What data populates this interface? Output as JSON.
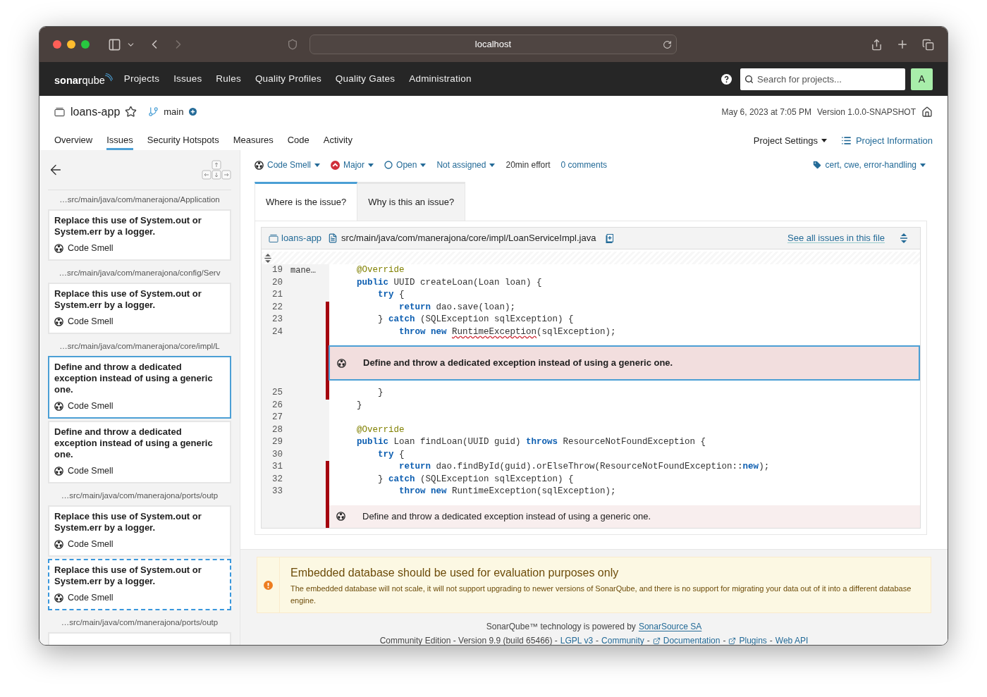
{
  "browser": {
    "url": "localhost"
  },
  "nav": {
    "logo": [
      "sonar",
      "qube"
    ],
    "items": [
      "Projects",
      "Issues",
      "Rules",
      "Quality Profiles",
      "Quality Gates",
      "Administration"
    ],
    "search": {
      "placeholder": "Search for projects..."
    },
    "avatar": "A"
  },
  "project": {
    "name": "loans-app",
    "branch": "main",
    "date": "May 6, 2023 at 7:05 PM",
    "version": "Version 1.0.0-SNAPSHOT"
  },
  "tabs": [
    {
      "label": "Overview",
      "selected": false
    },
    {
      "label": "Issues",
      "selected": true
    },
    {
      "label": "Security Hotspots",
      "selected": false
    },
    {
      "label": "Measures",
      "selected": false
    },
    {
      "label": "Code",
      "selected": false
    },
    {
      "label": "Activity",
      "selected": false
    }
  ],
  "project_settings": "Project Settings",
  "project_information": "Project Information",
  "sidebar": {
    "groups": [
      {
        "path": "…src/main/java/com/manerajona/Application",
        "issues": [
          {
            "message": "Replace this use of System.out or System.err by a logger.",
            "type": "Code Smell",
            "selected": false,
            "focused": false
          }
        ]
      },
      {
        "path": "…src/main/java/com/manerajona/config/Serv",
        "issues": [
          {
            "message": "Replace this use of System.out or System.err by a logger.",
            "type": "Code Smell",
            "selected": false,
            "focused": false
          }
        ]
      },
      {
        "path": "…src/main/java/com/manerajona/core/impl/L",
        "issues": [
          {
            "message": "Define and throw a dedicated exception instead of using a generic one.",
            "type": "Code Smell",
            "selected": true,
            "focused": false
          },
          {
            "message": "Define and throw a dedicated exception instead of using a generic one.",
            "type": "Code Smell",
            "selected": false,
            "focused": false
          }
        ]
      },
      {
        "path": "…src/main/java/com/manerajona/ports/outp",
        "issues": [
          {
            "message": "Replace this use of System.out or System.err by a logger.",
            "type": "Code Smell",
            "selected": false,
            "focused": false
          },
          {
            "message": "Replace this use of System.out or System.err by a logger.",
            "type": "Code Smell",
            "selected": false,
            "focused": true
          }
        ]
      },
      {
        "path": "…src/main/java/com/manerajona/ports/outp"
      }
    ]
  },
  "issue_meta": [
    {
      "kind": "type",
      "text": "Code Smell"
    },
    {
      "kind": "severity",
      "text": "Major"
    },
    {
      "kind": "status",
      "text": "Open"
    },
    {
      "kind": "assignee",
      "text": "Not assigned"
    },
    {
      "kind": "effort",
      "text": "20min effort"
    },
    {
      "kind": "comments",
      "text": "0 comments"
    }
  ],
  "tags": "cert, cwe, error-handling",
  "issue_tabs": [
    {
      "label": "Where is the issue?",
      "selected": true
    },
    {
      "label": "Why is this an issue?",
      "selected": false
    }
  ],
  "viewer": {
    "project": "loans-app",
    "file": "src/main/java/com/manerajona/core/impl/LoanServiceImpl.java",
    "see_all": "See all issues in this file",
    "rows": [
      {
        "kind": "line",
        "number": "19",
        "author": "mane…",
        "flagged": false,
        "tokens": [
          {
            "kind": "annotation",
            "text": "    @Override"
          }
        ]
      },
      {
        "kind": "line",
        "number": "20",
        "flagged": false,
        "tokens": [
          {
            "kind": "keyword",
            "text": "    public"
          },
          {
            "kind": "plain",
            "text": " UUID createLoan(Loan loan) {"
          }
        ]
      },
      {
        "kind": "line",
        "number": "21",
        "flagged": false,
        "tokens": [
          {
            "kind": "keyword",
            "text": "        try"
          },
          {
            "kind": "plain",
            "text": " {"
          }
        ]
      },
      {
        "kind": "line",
        "number": "22",
        "flagged": true,
        "tokens": [
          {
            "kind": "keyword",
            "text": "            return"
          },
          {
            "kind": "plain",
            "text": " dao.save(loan);"
          }
        ]
      },
      {
        "kind": "line",
        "number": "23",
        "flagged": true,
        "tokens": [
          {
            "kind": "plain",
            "text": "        } "
          },
          {
            "kind": "keyword",
            "text": "catch"
          },
          {
            "kind": "plain",
            "text": " (SQLException sqlException) {"
          }
        ]
      },
      {
        "kind": "line",
        "number": "24",
        "flagged": true,
        "tokens": [
          {
            "kind": "keyword",
            "text": "            throw new "
          },
          {
            "kind": "error",
            "text": "RuntimeException"
          },
          {
            "kind": "plain",
            "text": "(sqlException);"
          }
        ]
      },
      {
        "kind": "issue",
        "flagged": true,
        "selected": true,
        "message": "Define and throw a dedicated exception instead of using a generic one."
      },
      {
        "kind": "line",
        "number": "25",
        "flagged": true,
        "tokens": [
          {
            "kind": "plain",
            "text": "        }"
          }
        ]
      },
      {
        "kind": "line",
        "number": "26",
        "flagged": false,
        "tokens": [
          {
            "kind": "plain",
            "text": "    }"
          }
        ]
      },
      {
        "kind": "line",
        "number": "27",
        "flagged": false
      },
      {
        "kind": "line",
        "number": "28",
        "flagged": false,
        "tokens": [
          {
            "kind": "annotation",
            "text": "    @Override"
          }
        ]
      },
      {
        "kind": "line",
        "number": "29",
        "flagged": false,
        "tokens": [
          {
            "kind": "keyword",
            "text": "    public"
          },
          {
            "kind": "plain",
            "text": " Loan findLoan(UUID guid) "
          },
          {
            "kind": "keyword",
            "text": "throws"
          },
          {
            "kind": "plain",
            "text": " ResourceNotFoundException {"
          }
        ]
      },
      {
        "kind": "line",
        "number": "30",
        "flagged": false,
        "tokens": [
          {
            "kind": "keyword",
            "text": "        try"
          },
          {
            "kind": "plain",
            "text": " {"
          }
        ]
      },
      {
        "kind": "line",
        "number": "31",
        "flagged": true,
        "tokens": [
          {
            "kind": "keyword",
            "text": "            return"
          },
          {
            "kind": "plain",
            "text": " dao.findById(guid).orElseThrow(ResourceNotFoundException::"
          },
          {
            "kind": "keyword",
            "text": "new"
          },
          {
            "kind": "plain",
            "text": ");"
          }
        ]
      },
      {
        "kind": "line",
        "number": "32",
        "flagged": true,
        "tokens": [
          {
            "kind": "plain",
            "text": "        } "
          },
          {
            "kind": "keyword",
            "text": "catch"
          },
          {
            "kind": "plain",
            "text": " (SQLException sqlException) {"
          }
        ]
      },
      {
        "kind": "line",
        "number": "33",
        "flagged": true,
        "tokens": [
          {
            "kind": "keyword",
            "text": "            throw new"
          },
          {
            "kind": "plain",
            "text": " RuntimeException(sqlException);"
          }
        ]
      },
      {
        "kind": "issue",
        "flagged": true,
        "selected": false,
        "message": "Define and throw a dedicated exception instead of using a generic one."
      }
    ]
  },
  "warning": {
    "title": "Embedded database should be used for evaluation purposes only",
    "text": "The embedded database will not scale, it will not support upgrading to newer versions of SonarQube, and there is no support for migrating your data out of it into a different database engine."
  },
  "footer": {
    "line1": [
      {
        "kind": "text",
        "text": "SonarQube™ technology is powered by"
      },
      {
        "kind": "link",
        "text": "SonarSource SA"
      }
    ],
    "line2": [
      {
        "kind": "text",
        "text": "Community Edition - Version 9.9 (build 65466) -"
      },
      {
        "kind": "link",
        "text": "LGPL v3"
      },
      {
        "kind": "text",
        "text": "-"
      },
      {
        "kind": "link",
        "text": "Community"
      },
      {
        "kind": "text",
        "text": "-"
      },
      {
        "kind": "external_link",
        "text": "Documentation"
      },
      {
        "kind": "text",
        "text": "-"
      },
      {
        "kind": "external_link",
        "text": "Plugins"
      },
      {
        "kind": "text",
        "text": "-"
      },
      {
        "kind": "link",
        "text": "Web API"
      }
    ]
  }
}
